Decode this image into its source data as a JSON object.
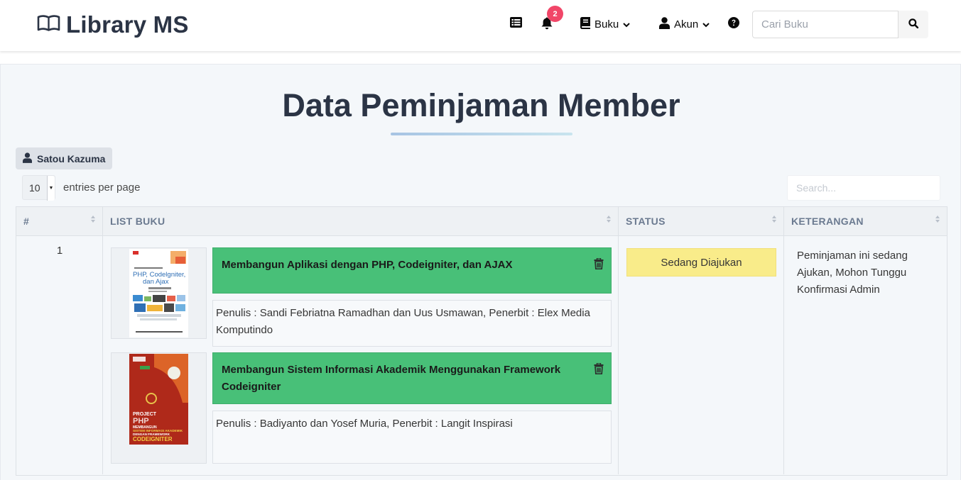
{
  "navbar": {
    "brand": "Library MS",
    "notifications_count": "2",
    "buku_label": "Buku",
    "akun_label": "Akun",
    "search_placeholder": "Cari Buku"
  },
  "page": {
    "title": "Data Peminjaman Member",
    "member_name": "Satou Kazuma"
  },
  "datatable": {
    "entries_value": "10",
    "entries_label": "entries per page",
    "search_placeholder": "Search..."
  },
  "table": {
    "headers": [
      "#",
      "LIST BUKU",
      "STATUS",
      "KETERANGAN"
    ],
    "rows": [
      {
        "number": "1",
        "books": [
          {
            "title": "Membangun Aplikasi dengan PHP, Codeigniter, dan AJAX",
            "info": "Penulis : Sandi Febriatna Ramadhan dan Uus Usmawan, Penerbit : Elex Media Komputindo",
            "cover_text": [
              "PHP, Codelgniter,",
              "dan Ajax"
            ]
          },
          {
            "title": "Membangun Sistem Informasi Akademik Menggunakan Framework Codeigniter",
            "info": "Penulis : Badiyanto dan Yosef Muria, Penerbit : Langit Inspirasi",
            "cover_text": [
              "PROJECT",
              "PHP",
              "MEMBANGUN",
              "SISTEM INFORMASI AKADEMIK",
              "DENGAN FRAMEWORK",
              "CODEIGNITER"
            ]
          }
        ],
        "status": "Sedang Diajukan",
        "keterangan": "Peminjaman ini sedang Ajukan, Mohon Tunggu Konfirmasi Admin"
      }
    ]
  },
  "colors": {
    "title_green": "#48c078",
    "status_yellow": "#f9ec8a",
    "badge_red": "#f14668",
    "heading_dark": "#2b3445"
  },
  "icons": [
    "book-open-icon",
    "list-icon",
    "bell-icon",
    "book-icon",
    "user-icon",
    "chevron-down-icon",
    "question-circle-icon",
    "search-icon",
    "trash-icon",
    "sort-icon"
  ]
}
